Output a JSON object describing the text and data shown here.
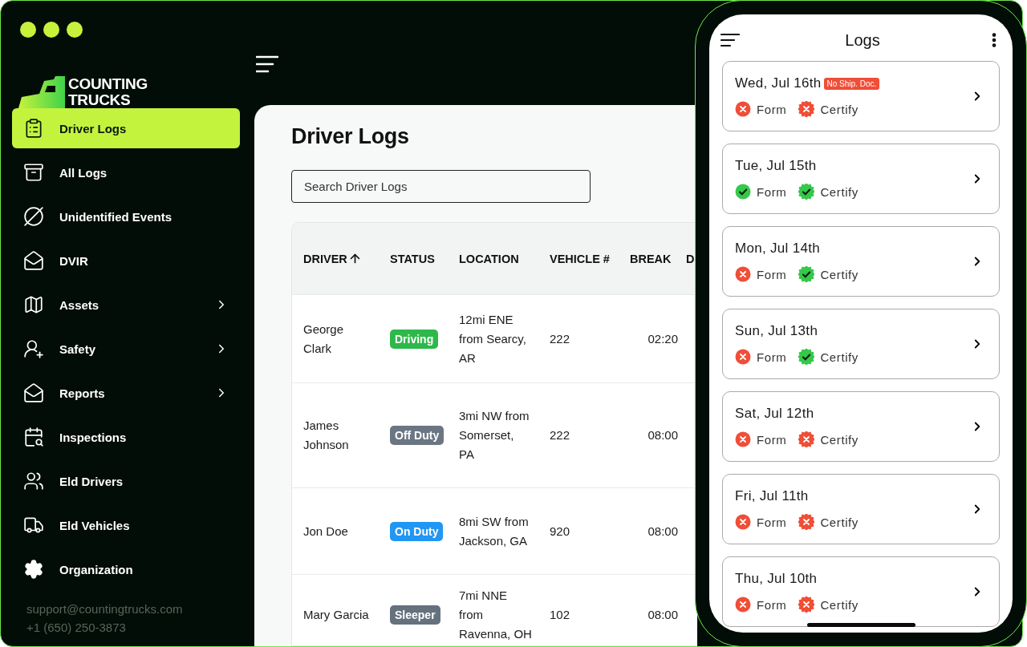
{
  "window": {
    "brand": [
      "COUNTING",
      "TRUCKS"
    ]
  },
  "sidebar": {
    "items": [
      {
        "label": "Driver Logs",
        "selected": true,
        "has_submenu": false
      },
      {
        "label": "All Logs",
        "selected": false,
        "has_submenu": false
      },
      {
        "label": "Unidentified Events",
        "selected": false,
        "has_submenu": false
      },
      {
        "label": "DVIR",
        "selected": false,
        "has_submenu": false
      },
      {
        "label": "Assets",
        "selected": false,
        "has_submenu": true
      },
      {
        "label": "Safety",
        "selected": false,
        "has_submenu": true
      },
      {
        "label": "Reports",
        "selected": false,
        "has_submenu": true
      },
      {
        "label": "Inspections",
        "selected": false,
        "has_submenu": false
      },
      {
        "label": "Eld Drivers",
        "selected": false,
        "has_submenu": false
      },
      {
        "label": "Eld Vehicles",
        "selected": false,
        "has_submenu": false
      },
      {
        "label": "Organization",
        "selected": false,
        "has_submenu": false
      }
    ],
    "footer": [
      "support@countingtrucks.com",
      "+1 (650) 250-3873"
    ]
  },
  "main": {
    "title": "Driver Logs",
    "search": {
      "placeholder": "Search Driver Logs"
    },
    "table": {
      "columns": [
        {
          "label": "DRIVER",
          "sorted": true
        },
        {
          "label": "STATUS",
          "sorted": false
        },
        {
          "label": "LOCATION",
          "sorted": false
        },
        {
          "label": "VEHICLE #",
          "sorted": false
        },
        {
          "label": "BREAK",
          "sorted": false
        },
        {
          "label": "D",
          "sorted": false
        }
      ],
      "rows": [
        {
          "driver": "George Clark",
          "status": {
            "label": "Driving",
            "color": "#2eb84b"
          },
          "location": "12mi ENE from Searcy, AR",
          "vehicle": "222",
          "break": "02:20"
        },
        {
          "driver": "James Johnson",
          "status": {
            "label": "Off Duty",
            "color": "#6b7683"
          },
          "location": "3mi NW from Somerset, PA",
          "vehicle": "222",
          "break": "08:00"
        },
        {
          "driver": "Jon Doe",
          "status": {
            "label": "On Duty",
            "color": "#2196f3"
          },
          "location": "8mi SW from Jackson, GA",
          "vehicle": "920",
          "break": "08:00"
        },
        {
          "driver": "Mary Garcia",
          "status": {
            "label": "Sleeper",
            "color": "#66717e"
          },
          "location": "7mi NNE from Ravenna, OH",
          "vehicle": "102",
          "break": "08:00"
        }
      ]
    }
  },
  "phone": {
    "title": "Logs",
    "logs": [
      {
        "date": "Wed, Jul 16th",
        "badge": "No Ship. Doc.",
        "form": {
          "label": "Form",
          "done": false
        },
        "certify": {
          "label": "Certify",
          "done": false
        }
      },
      {
        "date": "Tue, Jul 15th",
        "form": {
          "label": "Form",
          "done": true
        },
        "certify": {
          "label": "Certify",
          "done": true
        }
      },
      {
        "date": "Mon, Jul 14th",
        "form": {
          "label": "Form",
          "done": false
        },
        "certify": {
          "label": "Certify",
          "done": true
        }
      },
      {
        "date": "Sun, Jul 13th",
        "form": {
          "label": "Form",
          "done": false
        },
        "certify": {
          "label": "Certify",
          "done": true
        }
      },
      {
        "date": "Sat, Jul 12th",
        "form": {
          "label": "Form",
          "done": false
        },
        "certify": {
          "label": "Certify",
          "done": false
        }
      },
      {
        "date": "Fri, Jul 11th",
        "form": {
          "label": "Form",
          "done": false
        },
        "certify": {
          "label": "Certify",
          "done": false
        }
      },
      {
        "date": "Thu, Jul 10th",
        "form": {
          "label": "Form",
          "done": false
        },
        "certify": {
          "label": "Certify",
          "done": false
        }
      }
    ]
  }
}
